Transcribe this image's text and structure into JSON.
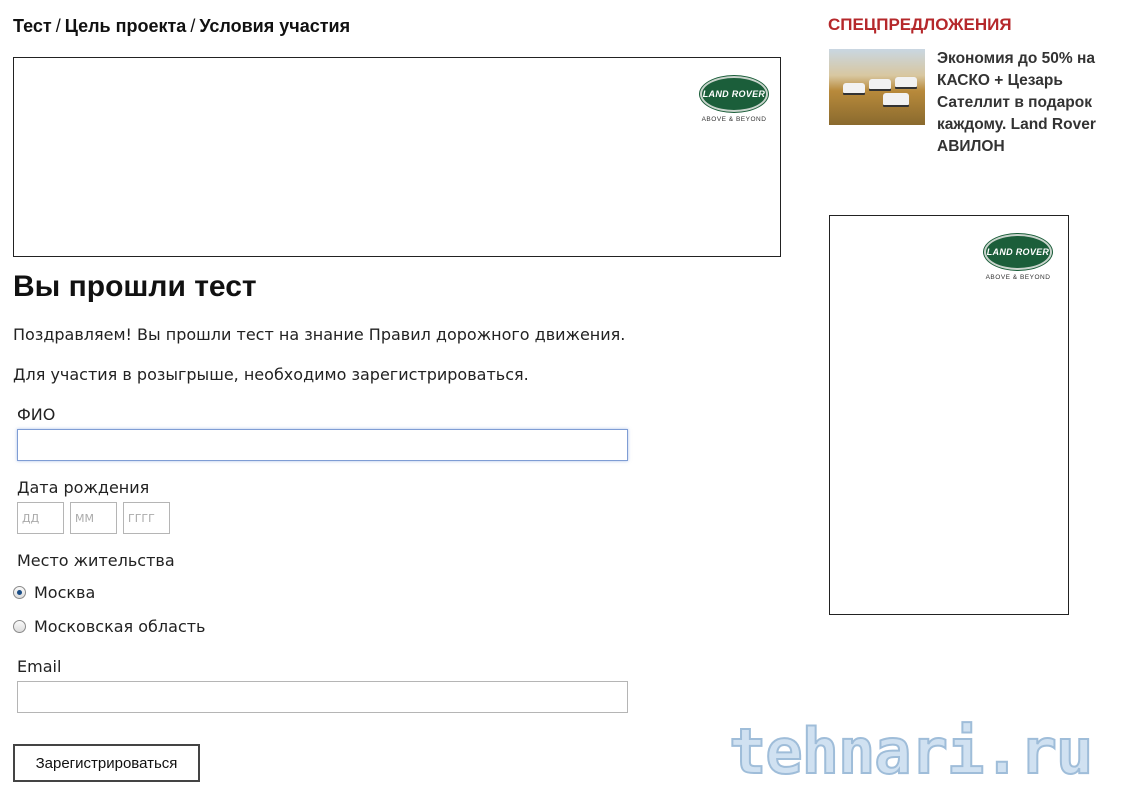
{
  "breadcrumb": {
    "items": [
      "Тест",
      "Цель проекта",
      "Условия участия"
    ],
    "separator": "/"
  },
  "banner": {
    "logo_text": "LAND ROVER",
    "logo_tagline": "ABOVE & BEYOND",
    "logo_color": "#1b5e3a"
  },
  "main": {
    "title": "Вы прошли тест",
    "congrats_text": "Поздравляем! Вы прошли тест на знание Правил дорожного движения.",
    "register_text": "Для участия в розыгрыше, необходимо зарегистрироваться."
  },
  "form": {
    "fio_label": "ФИО",
    "fio_value": "",
    "dob_label": "Дата рождения",
    "dob_day_placeholder": "ДД",
    "dob_month_placeholder": "ММ",
    "dob_year_placeholder": "ГГГГ",
    "place_label": "Место жительства",
    "place_options": [
      {
        "label": "Москва",
        "checked": true
      },
      {
        "label": "Московская область",
        "checked": false
      }
    ],
    "email_label": "Email",
    "email_value": "",
    "submit_label": "Зарегистрироваться"
  },
  "sidebar": {
    "special_heading": "СПЕЦПРЕДЛОЖЕНИЯ",
    "heading_color": "#b5282b",
    "offer_text": "Экономия до 50% на КАСКО + Цезарь Сателлит в подарок каждому. Land Rover АВИЛОН"
  },
  "side_ad": {
    "logo_text": "LAND ROVER",
    "logo_tagline": "ABOVE & BEYOND"
  },
  "watermark": "tehnari.ru"
}
